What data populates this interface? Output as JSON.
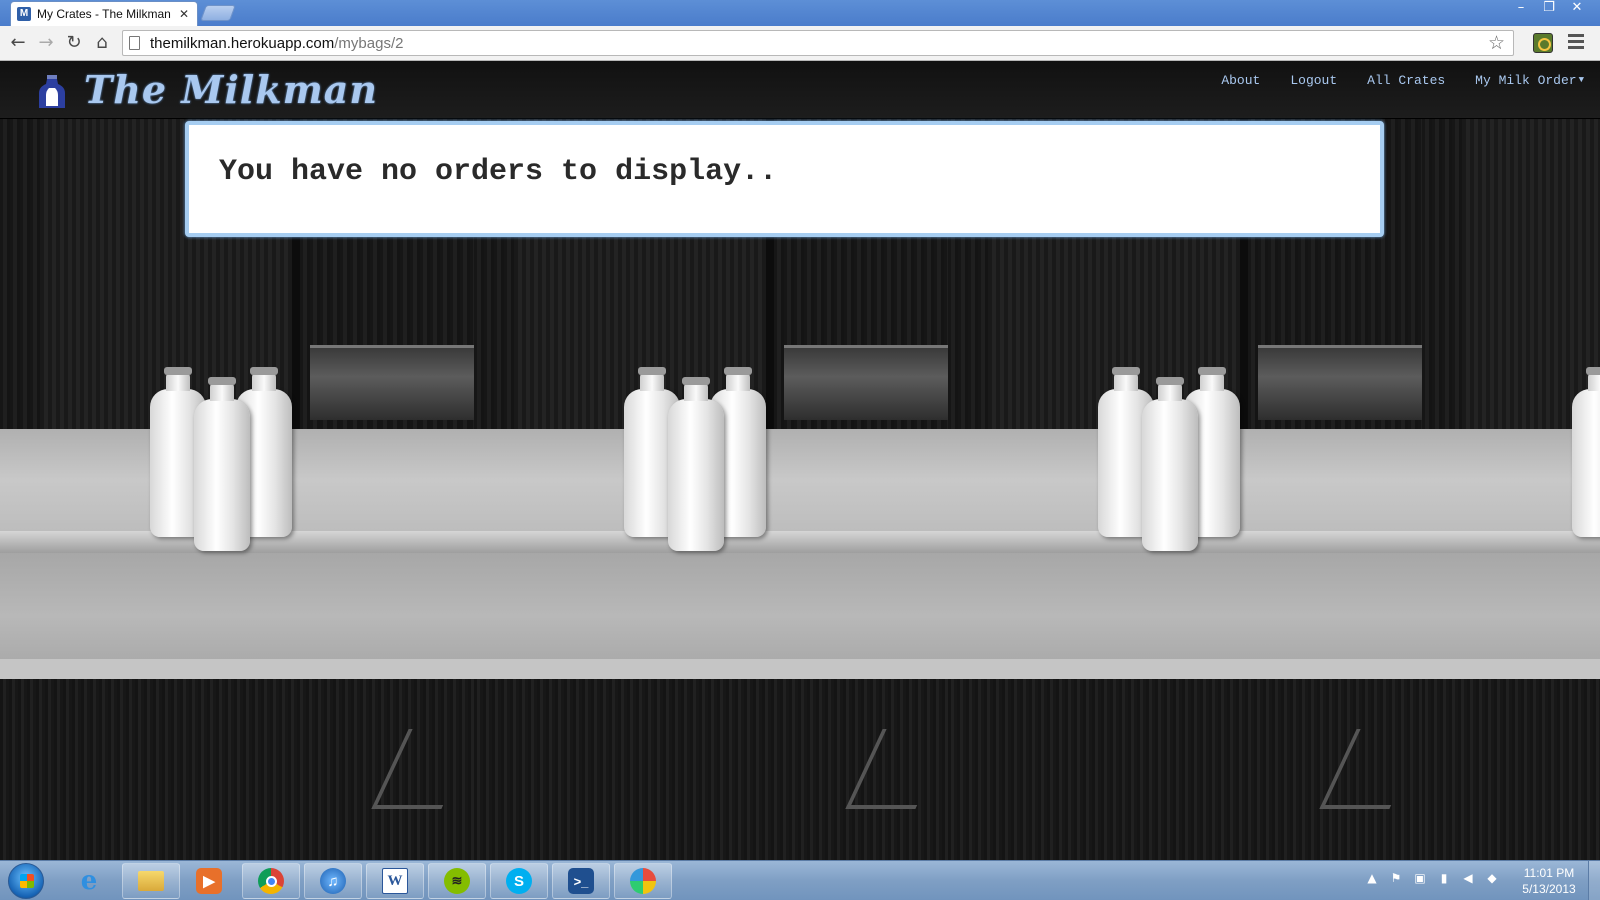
{
  "browser": {
    "tab_title": "My Crates - The Milkman",
    "tab_close": "✕",
    "url_host": "themilkman.herokuapp.com",
    "url_path": "/mybags/2",
    "window_controls": [
      "–",
      "❐",
      "✕"
    ],
    "nav_icons": [
      "back-arrow-icon",
      "forward-arrow-icon",
      "reload-icon",
      "home-icon"
    ]
  },
  "site": {
    "logo_text": "The Milkman",
    "nav": [
      {
        "label": "About"
      },
      {
        "label": "Logout"
      },
      {
        "label": "All Crates"
      },
      {
        "label": "My Milk Order"
      }
    ],
    "notice": "You have no orders to display.."
  },
  "taskbar": {
    "apps": [
      "internet-explorer",
      "file-explorer",
      "media-player",
      "chrome",
      "itunes",
      "word",
      "spotify",
      "skype",
      "powershell",
      "paint"
    ],
    "clock_time": "11:01 PM",
    "clock_date": "5/13/2013"
  },
  "colors": {
    "accent": "#a9c8ef",
    "navbar": "#151515",
    "notice_border": "#a6cdf1",
    "taskbar": "#7f9fc4"
  }
}
